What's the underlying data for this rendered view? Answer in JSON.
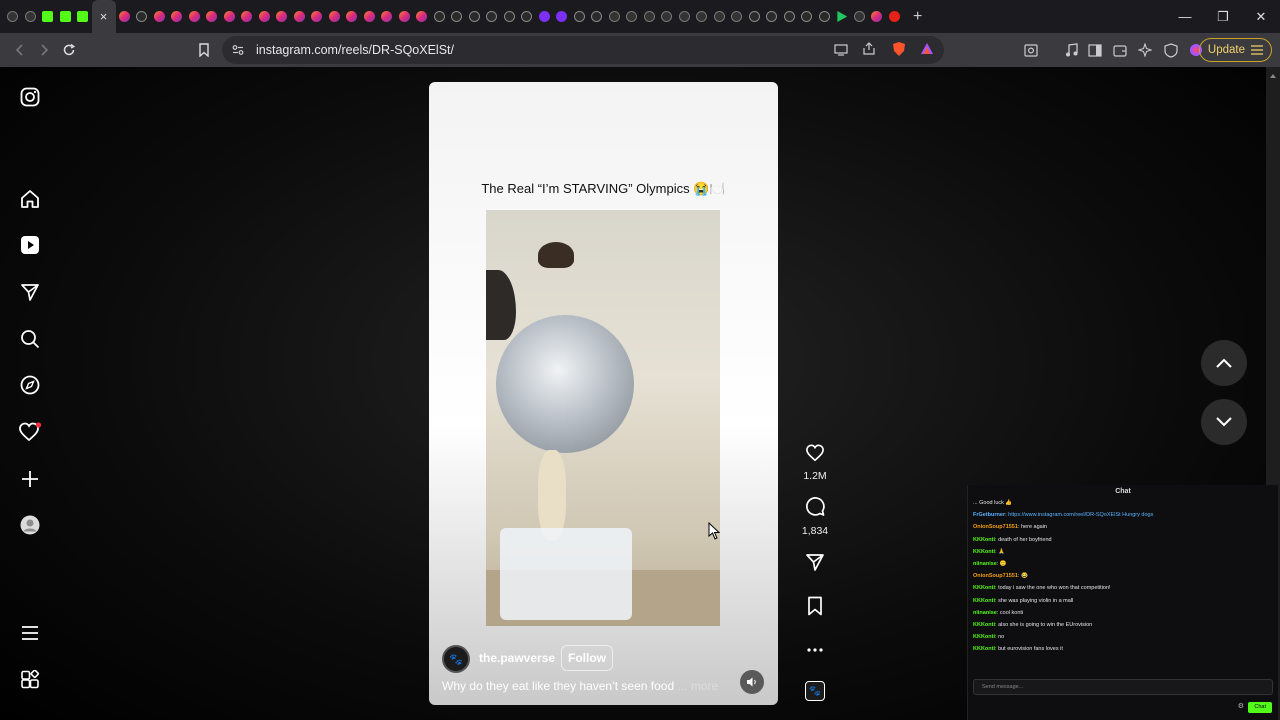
{
  "browser": {
    "tab_favicons": [
      "x",
      "x",
      "k",
      "k",
      "k",
      "active",
      "ig",
      "g",
      "ig",
      "ig",
      "ig",
      "ig",
      "ig",
      "ig",
      "ig",
      "ig",
      "ig",
      "ig",
      "ig",
      "ig",
      "ig",
      "ig",
      "ig",
      "ig",
      "g",
      "g",
      "g",
      "g",
      "g",
      "g",
      "pl",
      "pl",
      "g",
      "g",
      "x",
      "x",
      "x",
      "x",
      "x",
      "x",
      "x",
      "x",
      "g",
      "g",
      "g",
      "g",
      "g",
      "grn",
      "x",
      "ig",
      "yt"
    ],
    "active_tab_close": "×",
    "new_tab": "+",
    "url": "instagram.com/reels/DR-SQoXElSt/",
    "update_label": "Update",
    "window_controls": [
      "—",
      "❐",
      "✕"
    ]
  },
  "reel": {
    "title": "The Real “I’m STARVING” Olympics 😭🍽️",
    "username": "the.pawverse",
    "follow_label": "Follow",
    "caption": "Why do they eat like they haven’t seen food",
    "more_label": "... more",
    "avatar_glyph": "🐾"
  },
  "actions": {
    "likes": "1.2M",
    "comments": "1,834"
  },
  "chat": {
    "title": "Chat",
    "messages": [
      {
        "user": "",
        "text": "... Good luck 👍",
        "color": "#e6e6e6"
      },
      {
        "user": "FrGetburner",
        "text": "https://www.instagram.com/reel/DR-SQoXElSt Hungry dogs",
        "color": "#5ab4ff"
      },
      {
        "user": "OnionSoup71551",
        "text": "here again",
        "color": "#f59e0b"
      },
      {
        "user": "KKKonti",
        "text": "death of her boyfriend",
        "color": "#53fc18"
      },
      {
        "user": "KKKonti",
        "text": "🙏",
        "color": "#53fc18"
      },
      {
        "user": "niinanise",
        "text": "🙂",
        "color": "#53fc18"
      },
      {
        "user": "OnionSoup71551",
        "text": "😂",
        "color": "#f59e0b"
      },
      {
        "user": "KKKonti",
        "text": "today i saw the one who won that competition!",
        "color": "#53fc18"
      },
      {
        "user": "KKKonti",
        "text": "she was playing violin in a mall",
        "color": "#53fc18"
      },
      {
        "user": "niinanise",
        "text": "cool konti",
        "color": "#53fc18"
      },
      {
        "user": "KKKonti",
        "text": "also she is going to win the EUrovision",
        "color": "#53fc18"
      },
      {
        "user": "KKKonti",
        "text": "no",
        "color": "#53fc18"
      },
      {
        "user": "KKKonti",
        "text": "but eurovision fans loves it",
        "color": "#53fc18"
      }
    ],
    "input_placeholder": "Send message...",
    "send_label": "Chat"
  },
  "colors": {
    "accent_update": "#c9a227",
    "kick_green": "#53fc18",
    "notification_dot": "#ff3040"
  }
}
